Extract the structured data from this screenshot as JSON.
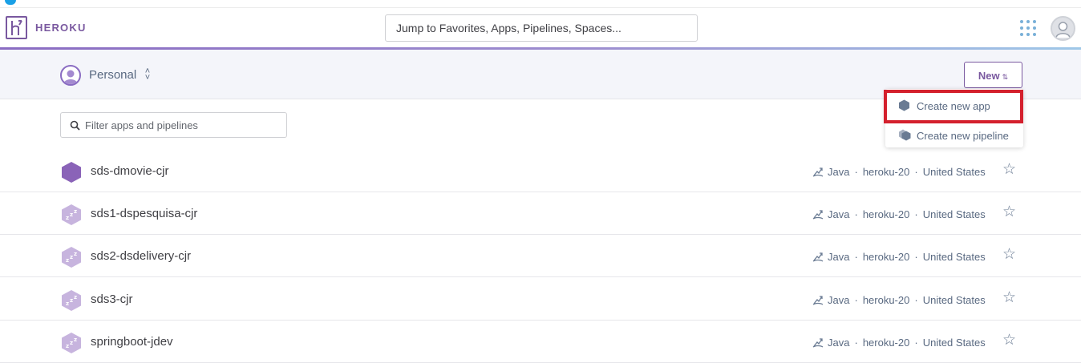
{
  "header": {
    "logo_text": "HEROKU",
    "search_placeholder": "Jump to Favorites, Apps, Pipelines, Spaces..."
  },
  "subheader": {
    "account_label": "Personal",
    "new_button_label": "New"
  },
  "filter": {
    "placeholder": "Filter apps and pipelines"
  },
  "new_menu": {
    "items": [
      {
        "label": "Create new app",
        "highlighted": true
      },
      {
        "label": "Create new pipeline",
        "highlighted": false
      }
    ]
  },
  "apps": [
    {
      "name": "sds-dmovie-cjr",
      "language": "Java",
      "stack": "heroku-20",
      "region": "United States",
      "state": "active"
    },
    {
      "name": "sds1-dspesquisa-cjr",
      "language": "Java",
      "stack": "heroku-20",
      "region": "United States",
      "state": "sleeping"
    },
    {
      "name": "sds2-dsdelivery-cjr",
      "language": "Java",
      "stack": "heroku-20",
      "region": "United States",
      "state": "sleeping"
    },
    {
      "name": "sds3-cjr",
      "language": "Java",
      "stack": "heroku-20",
      "region": "United States",
      "state": "sleeping"
    },
    {
      "name": "springboot-jdev",
      "language": "Java",
      "stack": "heroku-20",
      "region": "United States",
      "state": "sleeping"
    }
  ],
  "colors": {
    "brand_purple": "#79589f",
    "highlight_red": "#d4202d",
    "text_gray": "#596981"
  },
  "icons": {
    "grid": "apps-grid-icon",
    "search": "search-icon",
    "star": "star-icon",
    "java": "java-icon"
  }
}
